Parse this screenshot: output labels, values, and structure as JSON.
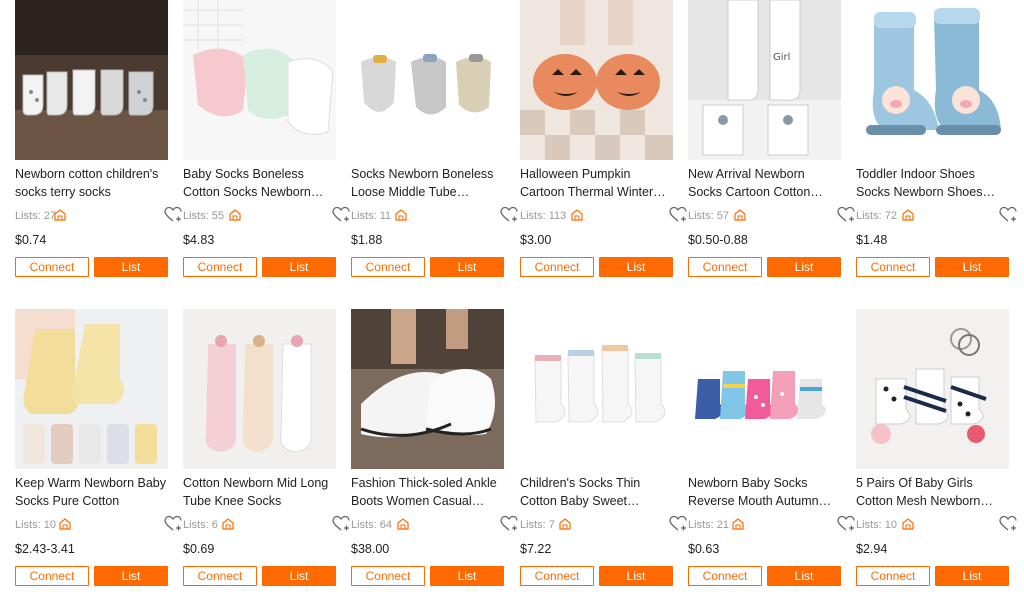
{
  "colors": {
    "accent": "#ff6a00",
    "muted": "#999999",
    "text": "#222222"
  },
  "labels": {
    "connect": "Connect",
    "list": "List"
  },
  "products": [
    {
      "title": "Newborn cotton children's socks terry socks",
      "lists": "Lists: 27",
      "price": "$0.74",
      "image": "five-baby-socks-on-wood"
    },
    {
      "title": "Baby Socks Boneless Cotton Socks Newborn Ba…",
      "lists": "Lists: 55",
      "price": "$4.83",
      "image": "pastel-baby-socks"
    },
    {
      "title": "Socks Newborn Boneless Loose Middle Tube Socks…",
      "lists": "Lists: 11",
      "price": "$1.88",
      "image": "three-car-socks"
    },
    {
      "title": "Halloween Pumpkin Cartoon Thermal Winter Cotton…",
      "lists": "Lists: 113",
      "price": "$3.00",
      "image": "pumpkin-slippers"
    },
    {
      "title": "New Arrival Newborn Socks Cartoon Cotton Baby Soc…",
      "lists": "Lists: 57",
      "price": "$0.50-0.88",
      "image": "boy-girl-socks"
    },
    {
      "title": "Toddler Indoor Shoes Socks Newborn Shoes Cotton…",
      "lists": "Lists: 72",
      "price": "$1.48",
      "image": "pig-shoe-socks"
    },
    {
      "title": "Keep Warm Newborn Baby Socks Pure Cotton",
      "lists": "Lists: 10",
      "price": "$2.43-3.41",
      "image": "yellow-baby-socks"
    },
    {
      "title": "Cotton Newborn Mid Long Tube Knee Socks",
      "lists": "Lists: 6",
      "price": "$0.69",
      "image": "knee-socks"
    },
    {
      "title": "Fashion Thick-soled Ankle Boots Women Casual…",
      "lists": "Lists: 64",
      "price": "$38.00",
      "image": "white-sock-sneakers"
    },
    {
      "title": "Children's Socks Thin Cotton Baby Sweet Carto…",
      "lists": "Lists: 7",
      "price": "$7.22",
      "image": "white-cartoon-socks"
    },
    {
      "title": "Newborn Baby Socks Reverse Mouth Autumn A…",
      "lists": "Lists: 21",
      "price": "$0.63",
      "image": "colorful-baby-socks"
    },
    {
      "title": "5 Pairs Of Baby Girls Cotton Mesh Newborn Socks",
      "lists": "Lists: 10",
      "price": "$2.94",
      "image": "dotted-girls-socks"
    }
  ]
}
